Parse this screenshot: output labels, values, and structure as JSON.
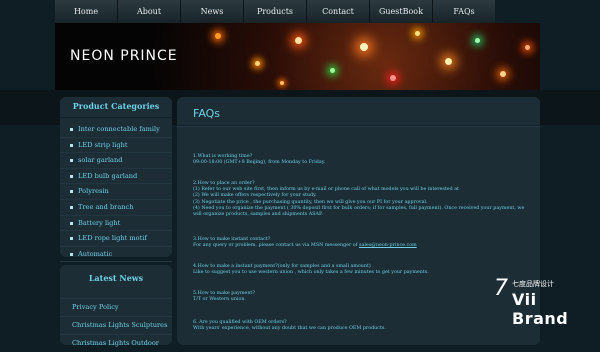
{
  "nav": {
    "items": [
      "Home",
      "About",
      "News",
      "Products",
      "Contact",
      "GuestBook",
      "FAQs"
    ]
  },
  "banner": {
    "title": "NEON PRINCE"
  },
  "sidebar": {
    "categories_title": "Product Categories",
    "categories": [
      "Inter connectable family",
      "LED strip light",
      "solar garland",
      "LED bulb garland",
      "Polyresin",
      "Tree and branch",
      "Battery light",
      "LED rope light motif",
      "Automatic"
    ],
    "news_title": "Latest News",
    "news": [
      "Privacy Policy",
      "Christmas Lights Sculptures",
      "Christmas Lights Outdoor"
    ]
  },
  "main": {
    "title": "FAQs",
    "faq1": [
      "1.What is working time?",
      "09:00-18:00 (GMT+8 Beijing), from Monday to Friday."
    ],
    "faq2": [
      "2.How to place an order?",
      "(1) Refer to our web site first, then inform us by e-mail or phone call of what models you will be interested at",
      "(2) We will make offers respectively for your study.",
      "(3) Negotiate the price , the purchasing quantity, then we will give you our PI for your approval.",
      "(4) Need you to organize the payment ( 30% deposit first for bulk orders; if for samples, full payment). Once received your payment, we",
      "will organize products, samples and shipments ASAP."
    ],
    "faq3_q": "3.How to make instant contact?",
    "faq3_a_prefix": "For any query or problem, please contact us via MSN messenger of",
    "faq3_email": "sales@neon-prince.com",
    "faq4": [
      "4.How to make a instant payment?(only for samples and a small amount)",
      "Like to suggest you to use western union                , which only takes a few minutes to get your payments."
    ],
    "faq5": [
      "5.How to make payment?",
      "T/T or Western union."
    ],
    "faq6": [
      "6. Are you qualified with OEM orders?",
      "With years' experience, without any doubt that we can produce OEM products."
    ]
  },
  "watermark": {
    "number": "7",
    "chinese": "七度品牌设计",
    "brand": "Vii Brand"
  }
}
